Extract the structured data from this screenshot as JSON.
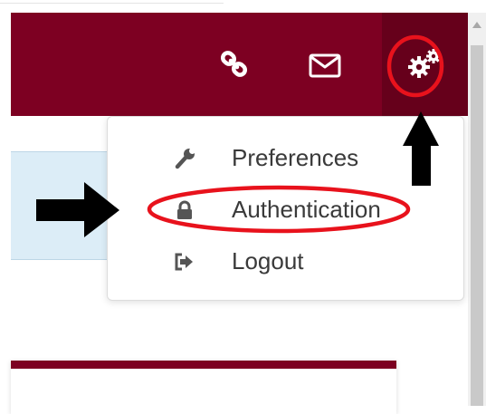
{
  "header": {
    "link_icon": "link-icon",
    "mail_icon": "envelope-icon",
    "settings_icon": "gears-icon"
  },
  "menu": {
    "items": [
      {
        "label": "Preferences",
        "icon": "wrench-icon"
      },
      {
        "label": "Authentication",
        "icon": "lock-icon"
      },
      {
        "label": "Logout",
        "icon": "sign-out-icon"
      }
    ]
  },
  "annotations": {
    "highlight_color": "#e8121c",
    "arrow_color": "#000000"
  },
  "theme": {
    "brand": "#7d0022",
    "brand_dark": "#66001b",
    "info_bg": "#dcedf7"
  }
}
